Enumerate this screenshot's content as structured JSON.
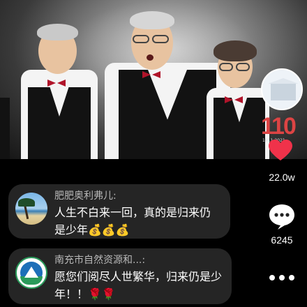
{
  "video": {
    "anniversary_number": "110",
    "anniversary_caption": "1911-2021"
  },
  "actions": {
    "like_icon": "heart-icon",
    "like_count": "22.0w",
    "comment_icon": "comment-bubble-icon",
    "comment_count": "6245",
    "more_icon": "more-dots-icon"
  },
  "comments": [
    {
      "name": "肥肥奥利弗儿:",
      "text": "人生不白来一回，真的是归来仍是少年💰💰💰"
    },
    {
      "name": "南充市自然资源和...:",
      "text": "愿您们阅尽人世繁华，归来仍是少年！！🌹🌹"
    }
  ],
  "colors": {
    "heart": "#f0324a",
    "bubble_bg": "#282828",
    "bow_tie": "#b0142a"
  }
}
